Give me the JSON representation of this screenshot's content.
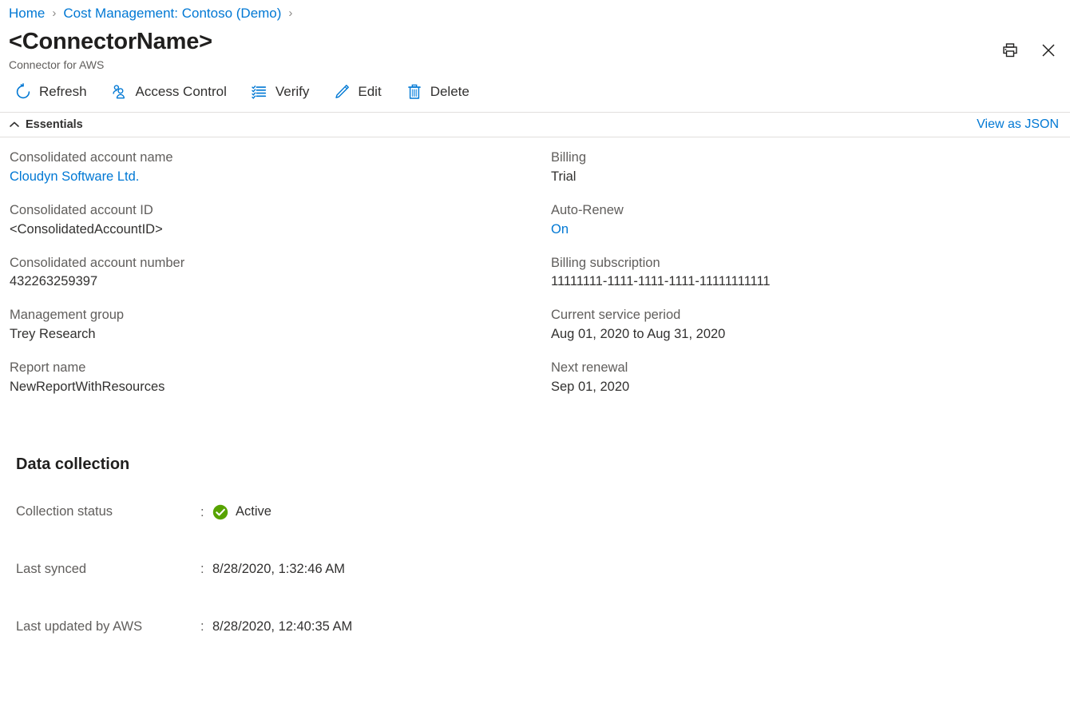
{
  "breadcrumb": {
    "items": [
      {
        "label": "Home"
      },
      {
        "label": "Cost Management: Contoso (Demo)"
      }
    ],
    "separator": "›"
  },
  "header": {
    "title": "<ConnectorName>",
    "subtitle": "Connector for AWS",
    "actions": [
      {
        "name": "print-icon",
        "label": "Print"
      },
      {
        "name": "close-icon",
        "label": "Close"
      }
    ]
  },
  "commandbar": {
    "items": [
      {
        "icon": "refresh-icon",
        "label": "Refresh"
      },
      {
        "icon": "access-control-icon",
        "label": "Access Control"
      },
      {
        "icon": "verify-list-icon",
        "label": "Verify"
      },
      {
        "icon": "edit-pencil-icon",
        "label": "Edit"
      },
      {
        "icon": "delete-trash-icon",
        "label": "Delete"
      }
    ]
  },
  "essentials": {
    "label": "Essentials",
    "chevron": "˄",
    "view_as_json": "View as JSON",
    "left_fields": [
      {
        "label": "Consolidated account name",
        "value": "Cloudyn Software Ltd.",
        "is_link": true
      },
      {
        "label": "Consolidated account ID",
        "value": "<ConsolidatedAccountID>",
        "is_link": false
      },
      {
        "label": "Consolidated account number",
        "value": "432263259397",
        "is_link": false
      },
      {
        "label": "Management group",
        "value": "Trey Research",
        "is_link": false
      },
      {
        "label": "Report name",
        "value": "NewReportWithResources",
        "is_link": false
      }
    ],
    "right_fields": [
      {
        "label": "Billing",
        "value": "Trial",
        "is_link": false
      },
      {
        "label": "Auto-Renew",
        "value": "On",
        "is_link": true
      },
      {
        "label": "Billing subscription",
        "value": "11111111-1111-1111-1111-11111111111",
        "is_link": false
      },
      {
        "label": "Current service period",
        "value": "Aug 01, 2020 to Aug 31, 2020",
        "is_link": false
      },
      {
        "label": "Next renewal",
        "value": "Sep 01, 2020",
        "is_link": false
      }
    ]
  },
  "data_collection": {
    "title": "Data collection",
    "colon": ":",
    "rows": [
      {
        "label": "Collection status",
        "value": "Active",
        "icon": "success-check-icon"
      },
      {
        "label": "Last synced",
        "value": "8/28/2020, 1:32:46 AM",
        "icon": ""
      },
      {
        "label": "Last updated by AWS",
        "value": "8/28/2020, 12:40:35 AM",
        "icon": ""
      }
    ]
  },
  "colors": {
    "accent": "#0078d4",
    "success_green": "#57a300",
    "text_primary": "#323130",
    "text_secondary": "#605e5c",
    "divider": "#e1dfdd"
  }
}
